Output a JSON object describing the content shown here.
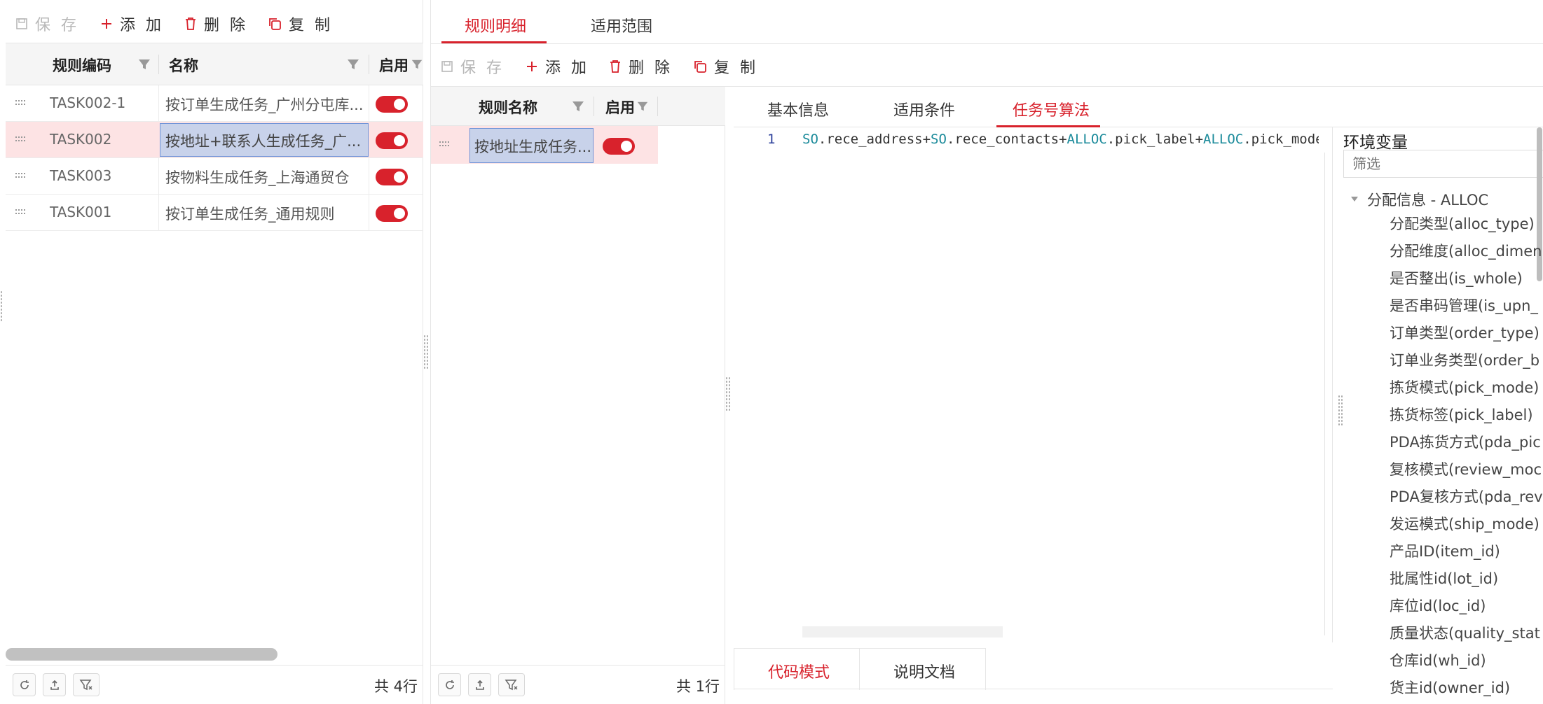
{
  "left_panel": {
    "toolbar": {
      "save": "保 存",
      "add": "添 加",
      "delete": "删 除",
      "copy": "复 制"
    },
    "columns": {
      "code": "规则编码",
      "name": "名称",
      "enabled": "启用"
    },
    "rows": [
      {
        "code": "TASK002-1",
        "name": "按订单生成任务_广州分屯库...",
        "enabled": true
      },
      {
        "code": "TASK002",
        "name": "按地址+联系人生成任务_广...",
        "enabled": true
      },
      {
        "code": "TASK003",
        "name": "按物料生成任务_上海通贸仓",
        "enabled": true
      },
      {
        "code": "TASK001",
        "name": "按订单生成任务_通用规则",
        "enabled": true
      }
    ],
    "total": "共 4行"
  },
  "right_tabs": {
    "items": [
      "规则明细",
      "适用范围"
    ],
    "active": 0
  },
  "middle_panel": {
    "toolbar": {
      "save": "保 存",
      "add": "添 加",
      "delete": "删 除",
      "copy": "复 制"
    },
    "columns": {
      "name": "规则名称",
      "enabled": "启用"
    },
    "rows": [
      {
        "name": "按地址生成任务...",
        "enabled": true
      }
    ],
    "total": "共 1行"
  },
  "detail_tabs": {
    "items": [
      "基本信息",
      "适用条件",
      "任务号算法"
    ],
    "active": 2
  },
  "editor": {
    "line_number": "1",
    "tokens": [
      {
        "t": "SO",
        "kw": true
      },
      {
        "t": ".rece_address+",
        "kw": false
      },
      {
        "t": "SO",
        "kw": true
      },
      {
        "t": ".rece_contacts+",
        "kw": false
      },
      {
        "t": "ALLOC",
        "kw": true
      },
      {
        "t": ".pick_label+",
        "kw": false
      },
      {
        "t": "ALLOC",
        "kw": true
      },
      {
        "t": ".pick_mode+A",
        "kw": false
      }
    ]
  },
  "bottom_tabs": {
    "items": [
      "代码模式",
      "说明文档"
    ],
    "active": 0
  },
  "env_panel": {
    "title": "环境变量",
    "filter_placeholder": "筛选",
    "group": "分配信息 - ALLOC",
    "items": [
      "分配类型(alloc_type)",
      "分配维度(alloc_dimen",
      "是否整出(is_whole)",
      "是否串码管理(is_upn_",
      "订单类型(order_type)",
      "订单业务类型(order_b",
      "拣货模式(pick_mode)",
      "拣货标签(pick_label)",
      "PDA拣货方式(pda_pic",
      "复核模式(review_moc",
      "PDA复核方式(pda_rev",
      "发运模式(ship_mode)",
      "产品ID(item_id)",
      "批属性id(lot_id)",
      "库位id(loc_id)",
      "质量状态(quality_stat",
      "仓库id(wh_id)",
      "货主id(owner_id)"
    ]
  }
}
